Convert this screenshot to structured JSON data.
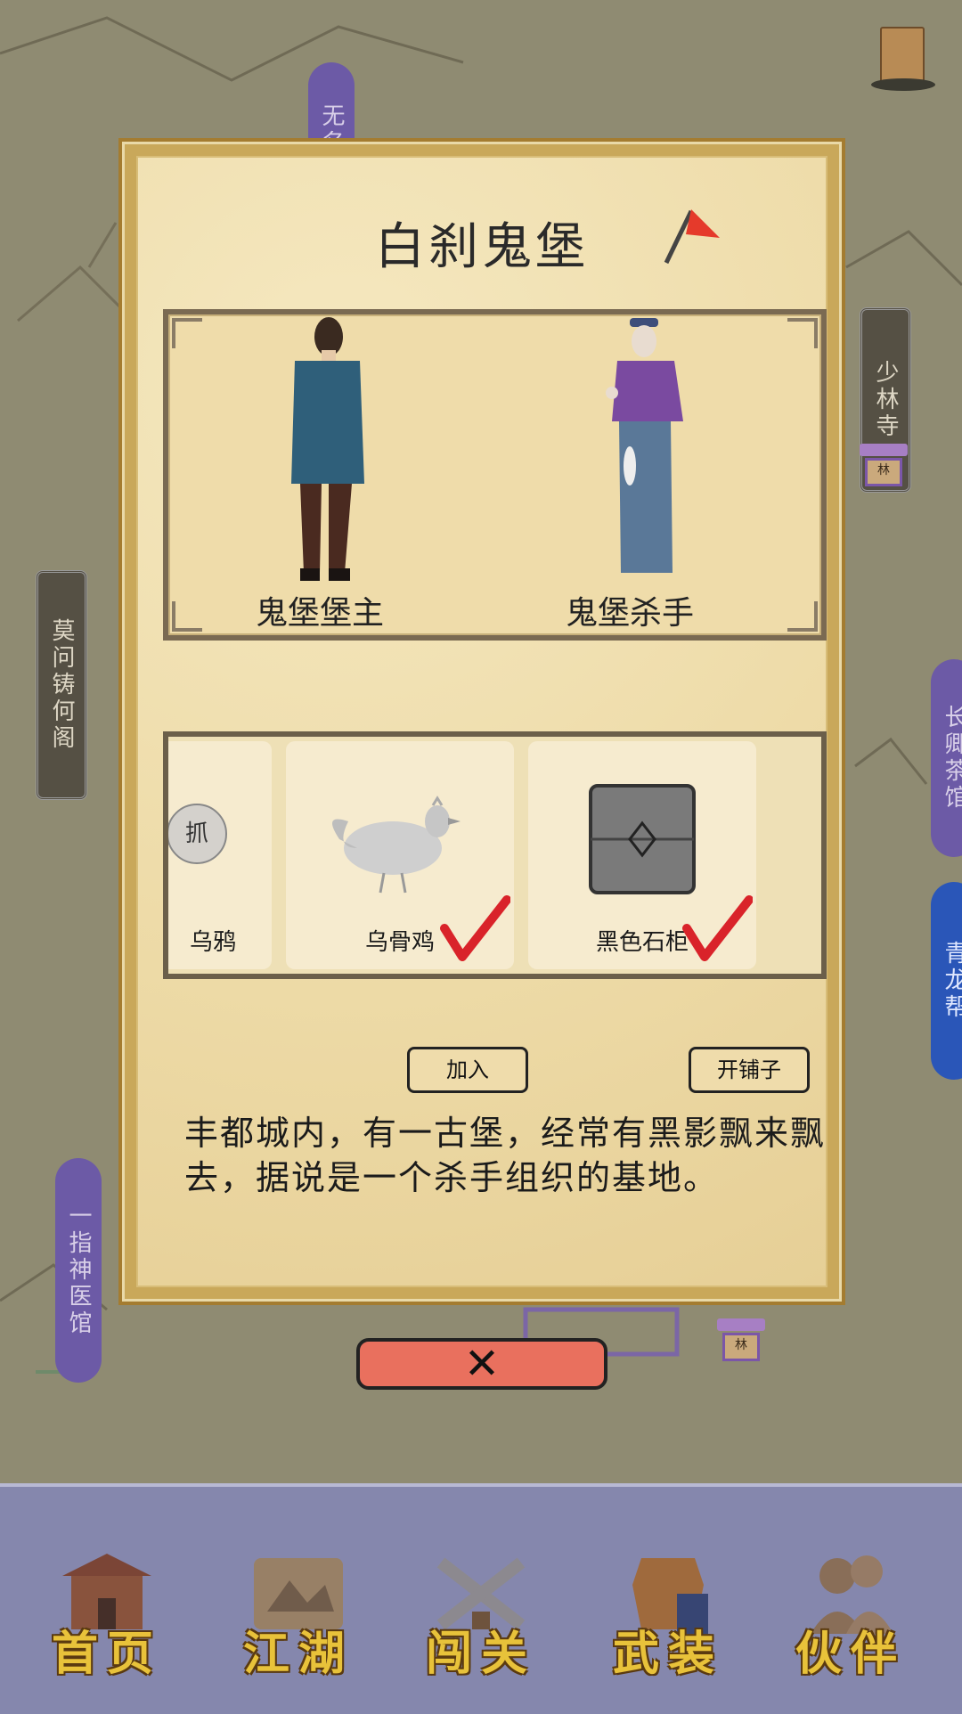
{
  "map": {
    "labels": [
      {
        "text": "无名",
        "style": "purple"
      },
      {
        "text": "少林寺",
        "style": "dark"
      },
      {
        "text": "莫问铸何阁",
        "style": "dark"
      },
      {
        "text": "长卿茶馆",
        "style": "purple"
      },
      {
        "text": "青龙帮",
        "style": "blue"
      },
      {
        "text": "一指神医馆",
        "style": "purple"
      }
    ],
    "shop_sign": "林"
  },
  "dialog": {
    "title": "白刹鬼堡",
    "npcs": [
      {
        "name": "鬼堡堡主"
      },
      {
        "name": "鬼堡杀手"
      }
    ],
    "items": [
      {
        "name": "乌鸦",
        "badge": "抓",
        "checked": false
      },
      {
        "name": "乌骨鸡",
        "checked": true
      },
      {
        "name": "黑色石柜",
        "checked": true
      }
    ],
    "join_label": "加入",
    "shop_label": "开铺子",
    "description": "丰都城内，有一古堡，经常有黑影飘来飘去，据说是一个杀手组织的基地。",
    "close_symbol": "✕"
  },
  "nav": {
    "items": [
      {
        "label": "首页",
        "icon": "house-icon"
      },
      {
        "label": "江湖",
        "icon": "scroll-map-icon"
      },
      {
        "label": "闯关",
        "icon": "crossed-swords-icon"
      },
      {
        "label": "武装",
        "icon": "armor-icon"
      },
      {
        "label": "伙伴",
        "icon": "companions-icon"
      }
    ]
  },
  "colors": {
    "accent_red": "#e53a2b",
    "check_red": "#d9232a",
    "nav_bg": "#8587ad",
    "nav_text": "#e8c23a"
  }
}
